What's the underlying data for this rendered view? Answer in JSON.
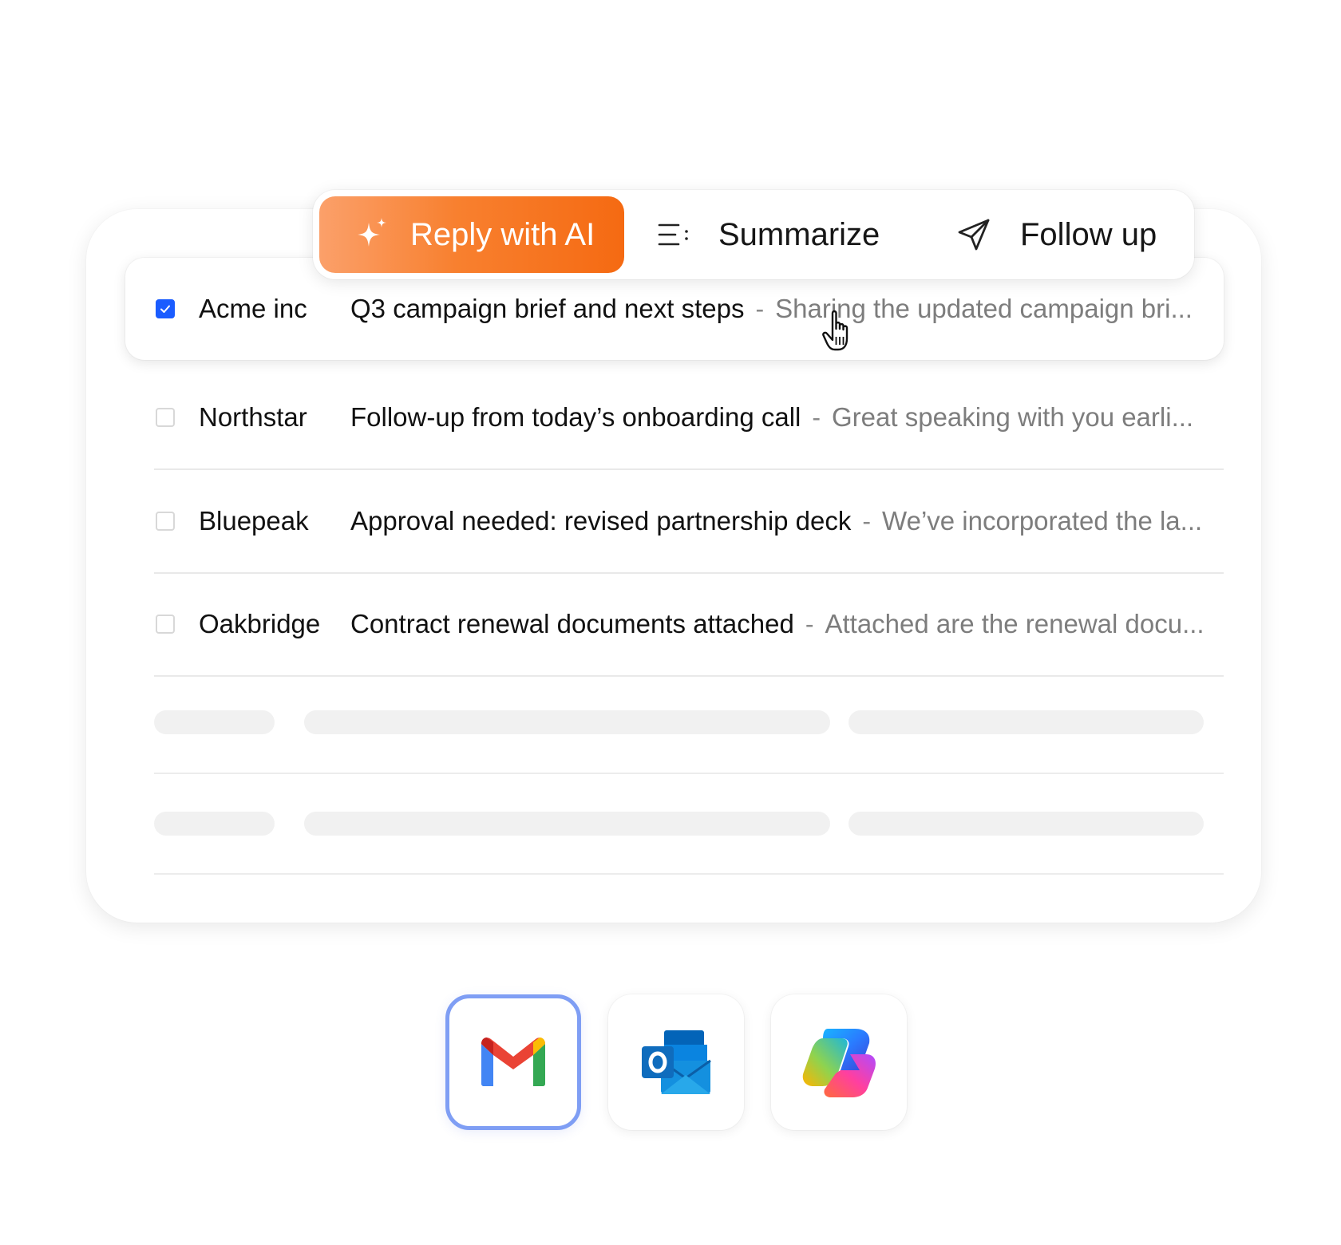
{
  "toolbar": {
    "reply_ai": "Reply with AI",
    "summarize": "Summarize",
    "follow_up": "Follow up"
  },
  "emails": [
    {
      "sender": "Acme inc",
      "subject": "Q3 campaign brief and next steps",
      "preview": "Sharing the updated campaign bri...",
      "checked": true
    },
    {
      "sender": "Northstar",
      "subject": "Follow-up from today’s onboarding call",
      "preview": "Great speaking with you earli...",
      "checked": false
    },
    {
      "sender": "Bluepeak",
      "subject": "Approval needed: revised partnership deck",
      "preview": "We’ve incorporated the la...",
      "checked": false
    },
    {
      "sender": "Oakbridge",
      "subject": "Contract renewal documents attached",
      "preview": "Attached are the renewal docu...",
      "checked": false
    }
  ],
  "separator": "-",
  "apps": [
    {
      "name": "gmail-icon",
      "active": true
    },
    {
      "name": "outlook-icon",
      "active": false
    },
    {
      "name": "copilot-icon",
      "active": false
    }
  ],
  "colors": {
    "accent_orange": "#f8802f",
    "checkbox_blue": "#1a5cff",
    "active_app_border": "#7f9ef4"
  }
}
